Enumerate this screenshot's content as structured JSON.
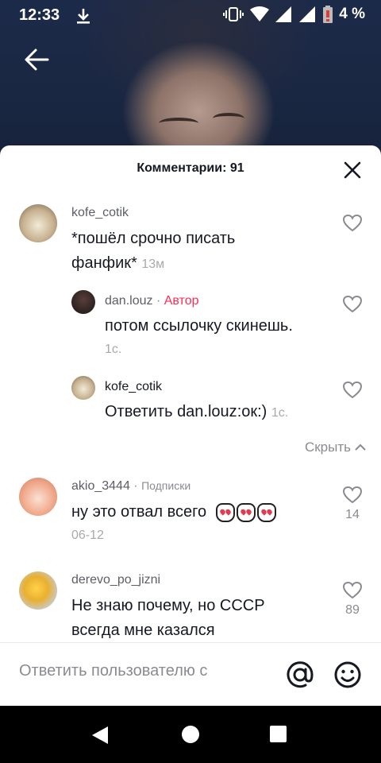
{
  "status_bar": {
    "time": "12:33",
    "battery": "4 %"
  },
  "sheet": {
    "title": "Комментарии: 91"
  },
  "comments": [
    {
      "user": "kofe_cotik",
      "text_line1": "*пошёл срочно писать",
      "text_line2": "фанфик*",
      "time": "13м"
    },
    {
      "user": "dan.louz",
      "sep": "·",
      "badge": "Автор",
      "text": "потом ссылочку скинешь.",
      "time": "1с."
    },
    {
      "user": "kofe_cotik",
      "reply_prefix": "Ответить",
      "mention": "dan.louz",
      "reply_text": ":ок:)",
      "time": "1с."
    },
    {
      "user": "akio_3444",
      "sep": "·",
      "badge": "Подписки",
      "text": "ну это отвал всего",
      "date": "06-12",
      "likes": "14"
    },
    {
      "user": "derevo_po_jizni",
      "text_line1": "Не знаю почему, но СССР",
      "text_line2": "всегда мне казался",
      "likes": "89"
    }
  ],
  "hide_label": "Скрыть",
  "input": {
    "placeholder": "Ответить пользователю с"
  },
  "colors": {
    "accent": "#fe2c55",
    "text": "#161823",
    "muted": "#8a8b91"
  }
}
